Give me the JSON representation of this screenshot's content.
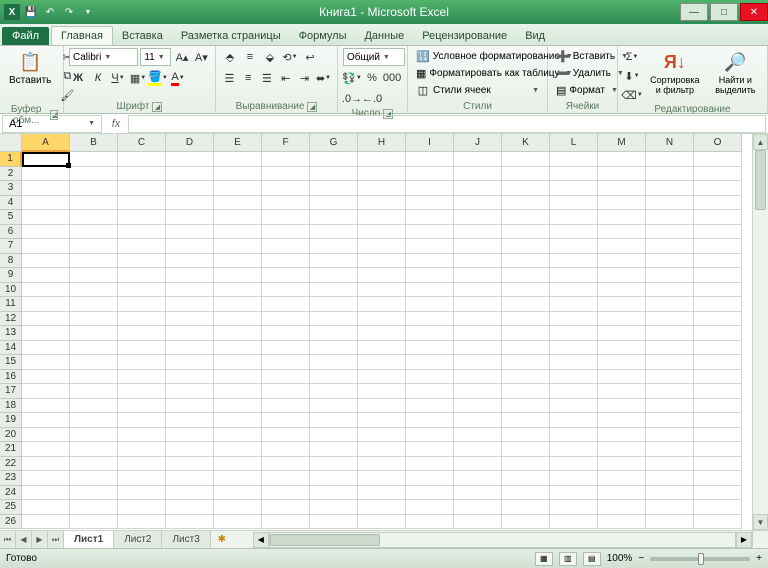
{
  "title": "Книга1 - Microsoft Excel",
  "tabs": {
    "file": "Файл",
    "home": "Главная",
    "insert": "Вставка",
    "page": "Разметка страницы",
    "formulas": "Формулы",
    "data": "Данные",
    "review": "Рецензирование",
    "view": "Вид"
  },
  "ribbon": {
    "clipboard": {
      "paste": "Вставить",
      "label": "Буфер обм..."
    },
    "font": {
      "name": "Calibri",
      "size": "11",
      "label": "Шрифт"
    },
    "alignment": {
      "label": "Выравнивание"
    },
    "number": {
      "format": "Общий",
      "label": "Число",
      "percent": "%",
      "thousands": "000"
    },
    "styles": {
      "cond": "Условное форматирование",
      "table": "Форматировать как таблицу",
      "cell": "Стили ячеек",
      "label": "Стили"
    },
    "cells": {
      "insert": "Вставить",
      "delete": "Удалить",
      "format": "Формат",
      "label": "Ячейки"
    },
    "editing": {
      "sort": "Сортировка и фильтр",
      "find": "Найти и выделить",
      "label": "Редактирование"
    }
  },
  "namebox": "A1",
  "columns": [
    "A",
    "B",
    "C",
    "D",
    "E",
    "F",
    "G",
    "H",
    "I",
    "J",
    "K",
    "L",
    "M",
    "N",
    "O"
  ],
  "rows": 26,
  "selected": {
    "col": 0,
    "row": 0
  },
  "sheets": {
    "s1": "Лист1",
    "s2": "Лист2",
    "s3": "Лист3"
  },
  "status": {
    "ready": "Готово",
    "zoom": "100%"
  }
}
